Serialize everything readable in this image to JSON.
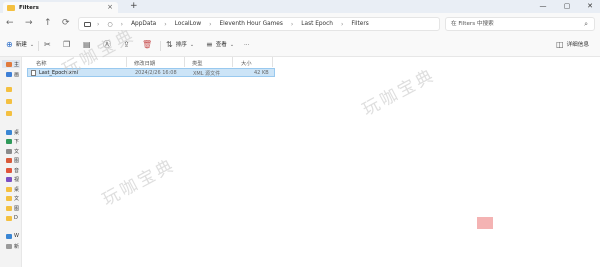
{
  "window": {
    "tab_title": "Filters",
    "new_tab_glyph": "+",
    "tab_close_glyph": "×",
    "minimize_glyph": "—",
    "maximize_glyph": "▢",
    "close_glyph": "✕"
  },
  "nav": {
    "back_glyph": "←",
    "forward_glyph": "→",
    "up_glyph": "↑",
    "refresh_glyph": "⟳"
  },
  "address": {
    "crumbs": [
      "AppData",
      "LocalLow",
      "Eleventh Hour Games",
      "Last Epoch",
      "Filters"
    ],
    "separator": "›"
  },
  "search": {
    "placeholder": "在 Filters 中搜索",
    "icon": "search-icon"
  },
  "toolbar": {
    "new_label": "新建",
    "sort_label": "排序",
    "view_label": "查看",
    "more_glyph": "···",
    "details_label": "详细信息"
  },
  "columns": {
    "name": "名称",
    "modified": "修改日期",
    "type": "类型",
    "size": "大小"
  },
  "files": [
    {
      "name": "Last_Epoch.xml",
      "modified": "2024/2/26 16:08",
      "type": "XML 源文件",
      "size": "42 KB"
    }
  ],
  "sidebar": {
    "items": [
      "主",
      "画",
      "",
      "",
      "",
      "桌",
      "下",
      "文",
      "图",
      "音",
      "视",
      "桌",
      "文",
      "图",
      "D",
      "W",
      "新"
    ]
  },
  "watermark": {
    "text": "玩咖宝典"
  },
  "colors": {
    "selected_row": "#cce4f7",
    "folder_yellow": "#f4c040",
    "accent_blue": "#2d6ec8"
  }
}
